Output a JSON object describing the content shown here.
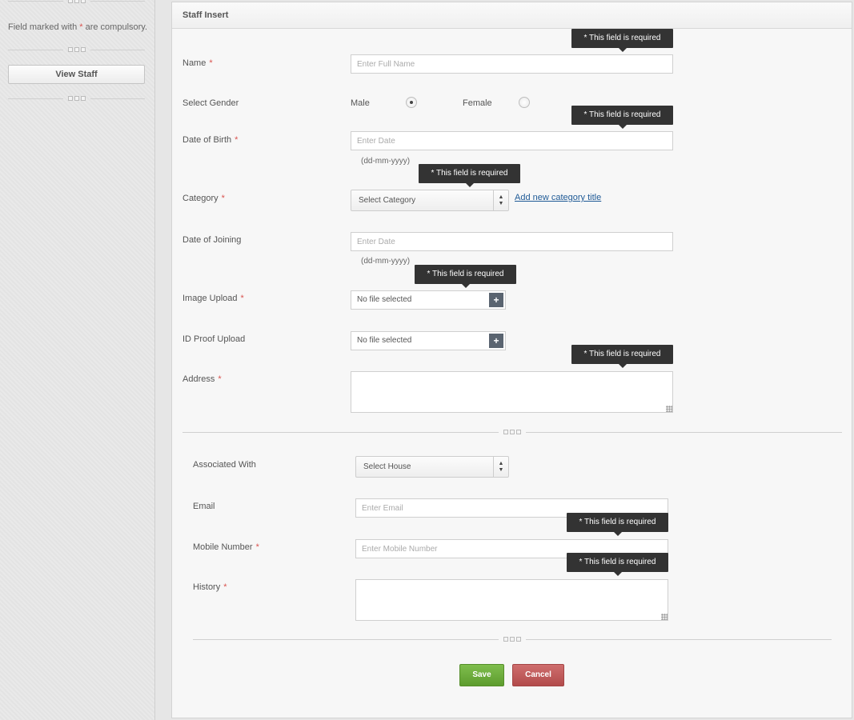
{
  "sidebar": {
    "note_before": "Field marked with ",
    "note_star": "*",
    "note_after": " are compulsory.",
    "view_staff_label": "View Staff"
  },
  "panel": {
    "title": "Staff Insert",
    "tooltip_required": "* This field is required",
    "req_star": "*",
    "fields": {
      "name": {
        "label": "Name",
        "placeholder": "Enter Full Name"
      },
      "gender": {
        "label": "Select Gender",
        "option_male": "Male",
        "option_female": "Female",
        "selected": "Male"
      },
      "dob": {
        "label": "Date of Birth",
        "placeholder": "Enter Date",
        "hint": "(dd-mm-yyyy)"
      },
      "category": {
        "label": "Category",
        "value": "Select Category",
        "add_link": "Add new category title"
      },
      "doj": {
        "label": "Date of Joining",
        "placeholder": "Enter Date",
        "hint": "(dd-mm-yyyy)"
      },
      "image_upload": {
        "label": "Image Upload",
        "value": "No file selected",
        "button": "+"
      },
      "id_proof": {
        "label": "ID Proof Upload",
        "value": "No file selected",
        "button": "+"
      },
      "address": {
        "label": "Address"
      },
      "associated": {
        "label": "Associated With",
        "value": "Select House"
      },
      "email": {
        "label": "Email",
        "placeholder": "Enter Email"
      },
      "mobile": {
        "label": "Mobile Number",
        "placeholder": "Enter Mobile Number"
      },
      "history": {
        "label": "History"
      }
    },
    "buttons": {
      "save": "Save",
      "cancel": "Cancel"
    }
  },
  "colors": {
    "required": "#d9534f",
    "save": "#6aab3a",
    "cancel": "#c05a5a",
    "tooltip": "#333333",
    "link": "#1f5a96"
  }
}
